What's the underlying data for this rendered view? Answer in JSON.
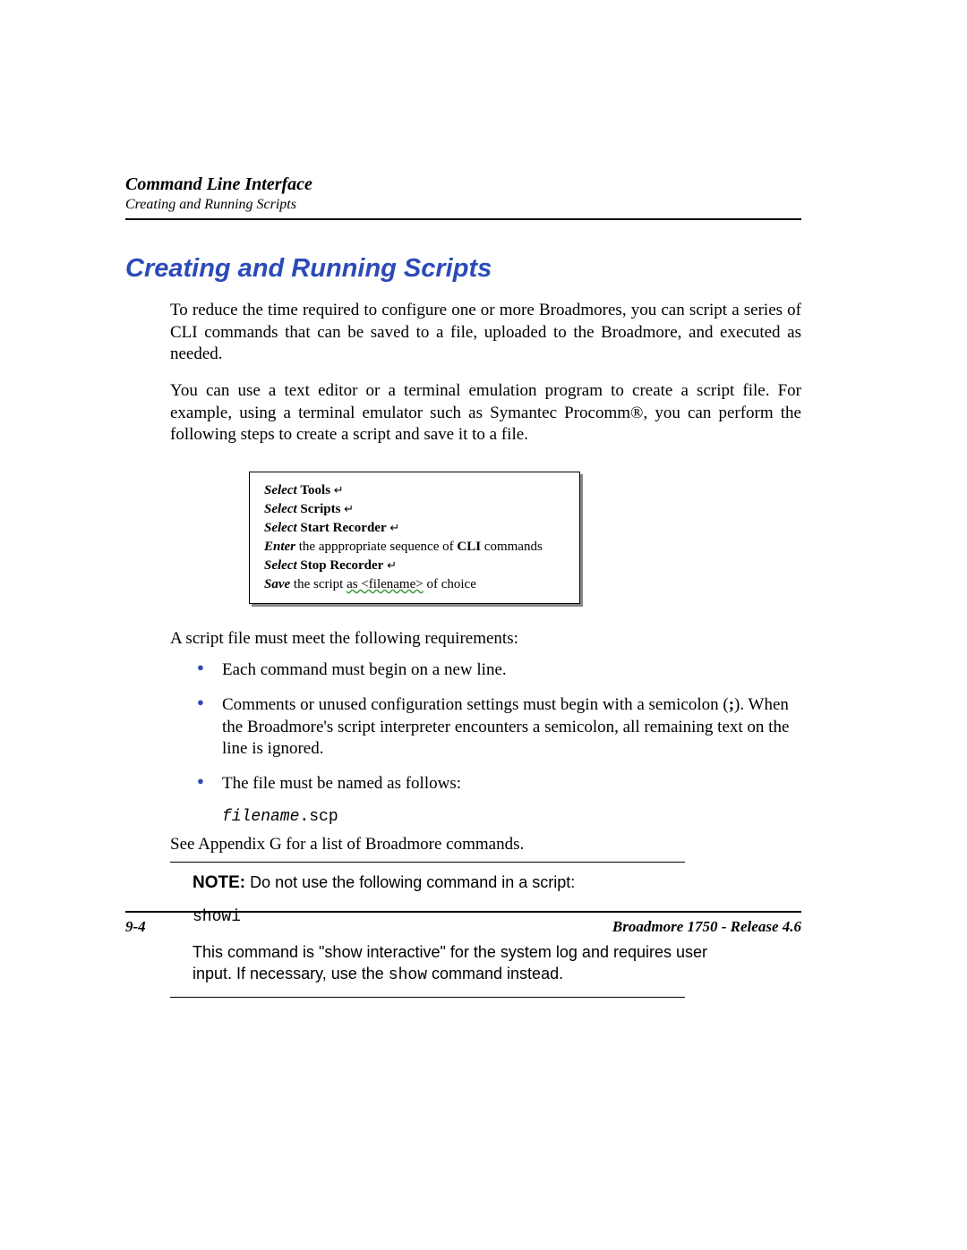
{
  "header": {
    "title": "Command Line Interface",
    "subtitle": "Creating and Running Scripts"
  },
  "section_title": "Creating and Running Scripts",
  "para1": "To reduce the time required to configure one or more Broadmores, you can script a series of CLI commands that can be saved to a file, uploaded to the Broadmore, and executed as needed.",
  "para2": "You can use a text editor or a terminal emulation program to create a script file. For example, using a terminal emulator such as Symantec Procomm®, you can perform the following steps to create a script and save it to a file.",
  "instructions": {
    "line1_action": "Select",
    "line1_bold": "Tools",
    "line2_action": "Select",
    "line2_bold": "Scripts",
    "line3_action": "Select",
    "line3_bold": "Start Recorder",
    "line4_action": "Enter",
    "line4_text": " the apppropriate sequence of ",
    "line4_bold": "CLI",
    "line4_tail": " commands",
    "line5_action": "Select",
    "line5_bold": "Stop Recorder",
    "line6_action": "Save",
    "line6_text_pre": " the script ",
    "line6_wavy": "as  <filename>",
    "line6_tail": " of choice"
  },
  "req_intro": "A script file must meet the following requirements:",
  "bullets": {
    "b1": "Each command must begin on a new line.",
    "b2_pre": "Comments or unused configuration settings must begin with a semicolon (",
    "b2_semi": ";",
    "b2_mid": "). When the Broadmore's script interpreter encounters a semicolon, all remaining text on the line is ignored.",
    "b3": "The file must be named as follows:"
  },
  "filename_italic": "filename",
  "filename_ext": ".scp",
  "see_text": "See Appendix G for a list of Broadmore commands.",
  "note": {
    "label": "NOTE:",
    "intro": "  Do not use the following command in a script:",
    "code": "showi",
    "body_pre": "This command is \"show interactive\" for the system log and requires user input. If necessary, use the ",
    "body_mono": "show",
    "body_post": " command instead."
  },
  "footer": {
    "left": "9-4",
    "right": "Broadmore 1750 - Release 4.6"
  }
}
